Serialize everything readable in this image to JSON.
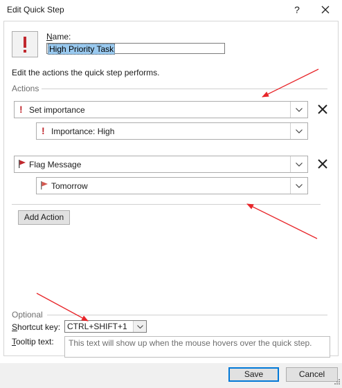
{
  "window": {
    "title": "Edit Quick Step",
    "help_label": "?"
  },
  "form": {
    "name_label": "Name:",
    "name_value": "High Priority Task",
    "description": "Edit the actions the quick step performs."
  },
  "actions": {
    "group_label": "Actions",
    "items": [
      {
        "label": "Set importance",
        "icon": "exclamation-icon",
        "sub_label": "Importance: High",
        "sub_icon": "exclamation-icon"
      },
      {
        "label": "Flag Message",
        "icon": "red-flag-icon",
        "sub_label": "Tomorrow",
        "sub_icon": "red-flag-icon"
      }
    ],
    "add_action_label": "Add Action"
  },
  "optional": {
    "group_label": "Optional",
    "shortcut_label": "Shortcut key:",
    "shortcut_value": "CTRL+SHIFT+1",
    "tooltip_label": "Tooltip text:",
    "tooltip_value": "This text will show up when the mouse hovers over the quick step."
  },
  "buttons": {
    "save": "Save",
    "cancel": "Cancel"
  },
  "colors": {
    "accent": "#0078d7",
    "important_red": "#c0272d",
    "selection": "#99c9ef",
    "annotation_arrow": "#e8262a"
  }
}
